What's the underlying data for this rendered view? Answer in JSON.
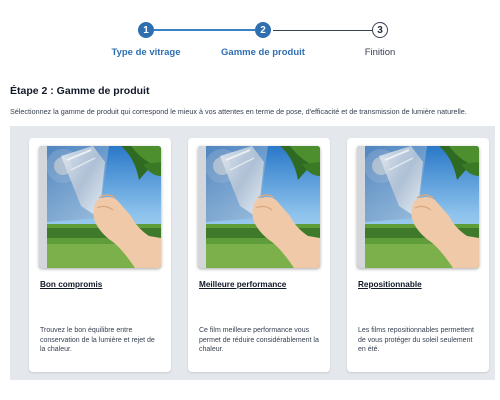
{
  "stepper": {
    "steps": [
      {
        "number": "1",
        "label": "Type de vitrage",
        "state": "completed"
      },
      {
        "number": "2",
        "label": "Gamme de produit",
        "state": "current"
      },
      {
        "number": "3",
        "label": "Finition",
        "state": "upcoming"
      }
    ],
    "accent_color": "#2f6fb0"
  },
  "section": {
    "title": "Étape 2 : Gamme de produit",
    "description": "Sélectionnez la gamme de produit qui correspond le mieux à vos attentes en terme de pose, d'efficacité et de transmission de lumière naturelle."
  },
  "products": [
    {
      "name": "Bon compromis",
      "description": "Trouvez le bon équilibre entre conservation de la lumière et rejet de la chaleur.",
      "image_icon": "window-film-peel-image"
    },
    {
      "name": "Meilleure performance",
      "description": "Ce film meilleure performance vous permet de réduire considérablement la chaleur.",
      "image_icon": "window-film-peel-image"
    },
    {
      "name": "Repositionnable",
      "description": "Les films repositionnables permettent de vous protéger du soleil seulement en été.",
      "image_icon": "window-film-peel-image"
    }
  ]
}
